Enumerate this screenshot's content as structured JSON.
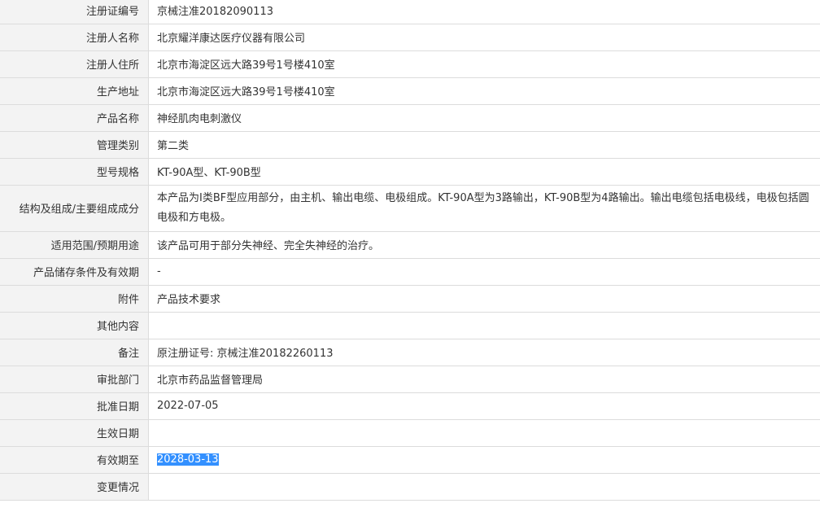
{
  "rows": [
    {
      "label": "注册证编号",
      "value": "京械注准20182090113"
    },
    {
      "label": "注册人名称",
      "value": "北京耀洋康达医疗仪器有限公司"
    },
    {
      "label": "注册人住所",
      "value": "北京市海淀区远大路39号1号楼410室"
    },
    {
      "label": "生产地址",
      "value": "北京市海淀区远大路39号1号楼410室"
    },
    {
      "label": "产品名称",
      "value": "神经肌肉电刺激仪"
    },
    {
      "label": "管理类别",
      "value": "第二类"
    },
    {
      "label": "型号规格",
      "value": "KT-90A型、KT-90B型"
    },
    {
      "label": "结构及组成/主要组成成分",
      "value": "本产品为Ⅰ类BF型应用部分，由主机、输出电缆、电极组成。KT-90A型为3路输出，KT-90B型为4路输出。输出电缆包括电极线，电极包括圆电极和方电极。"
    },
    {
      "label": "适用范围/预期用途",
      "value": "该产品可用于部分失神经、完全失神经的治疗。"
    },
    {
      "label": "产品储存条件及有效期",
      "value": "-"
    },
    {
      "label": "附件",
      "value": "产品技术要求"
    },
    {
      "label": "其他内容",
      "value": ""
    },
    {
      "label": "备注",
      "value": "原注册证号: 京械注准20182260113"
    },
    {
      "label": "审批部门",
      "value": "北京市药品监督管理局"
    },
    {
      "label": "批准日期",
      "value": "2022-07-05"
    },
    {
      "label": "生效日期",
      "value": ""
    },
    {
      "label": "有效期至",
      "value": "2028-03-13"
    },
    {
      "label": "变更情况",
      "value": ""
    }
  ]
}
